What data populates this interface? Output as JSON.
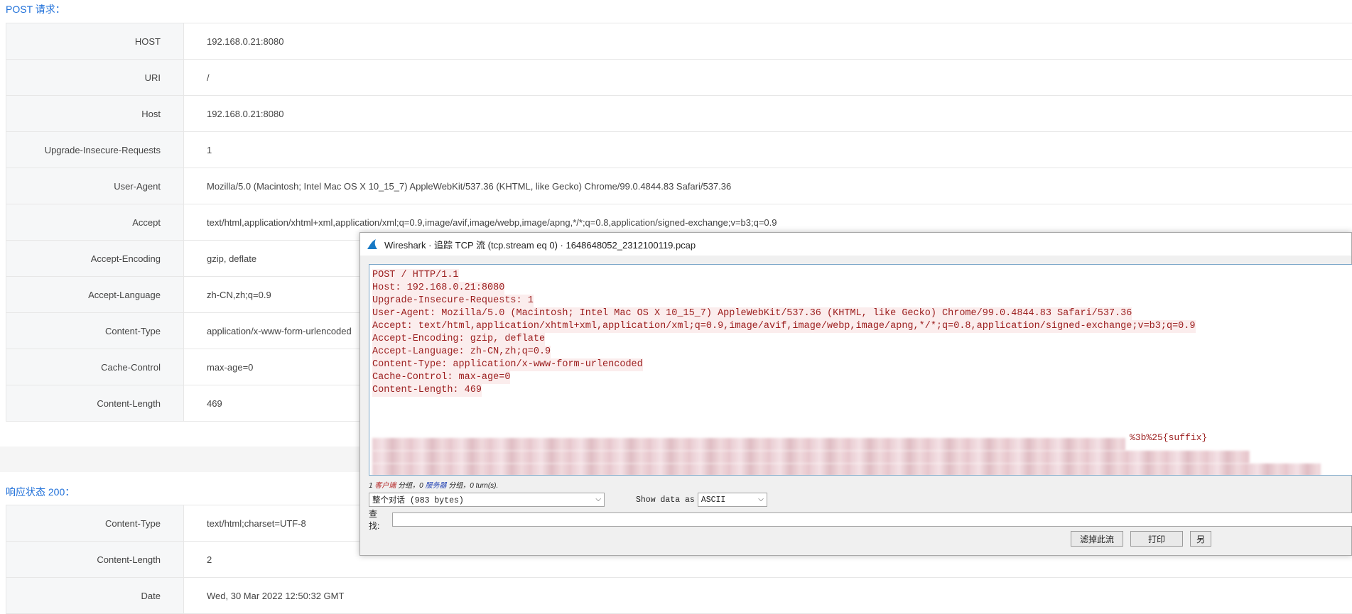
{
  "request": {
    "title": "POST 请求：",
    "rows": [
      {
        "key": "HOST",
        "value": "192.168.0.21:8080"
      },
      {
        "key": "URI",
        "value": "/"
      },
      {
        "key": "Host",
        "value": "192.168.0.21:8080"
      },
      {
        "key": "Upgrade-Insecure-Requests",
        "value": "1"
      },
      {
        "key": "User-Agent",
        "value": "Mozilla/5.0 (Macintosh; Intel Mac OS X 10_15_7) AppleWebKit/537.36 (KHTML, like Gecko) Chrome/99.0.4844.83 Safari/537.36"
      },
      {
        "key": "Accept",
        "value": "text/html,application/xhtml+xml,application/xml;q=0.9,image/avif,image/webp,image/apng,*/*;q=0.8,application/signed-exchange;v=b3;q=0.9"
      },
      {
        "key": "Accept-Encoding",
        "value": "gzip, deflate"
      },
      {
        "key": "Accept-Language",
        "value": "zh-CN,zh;q=0.9"
      },
      {
        "key": "Content-Type",
        "value": "application/x-www-form-urlencoded"
      },
      {
        "key": "Cache-Control",
        "value": "max-age=0"
      },
      {
        "key": "Content-Length",
        "value": "469"
      }
    ]
  },
  "response": {
    "title": "响应状态 200：",
    "rows": [
      {
        "key": "Content-Type",
        "value": "text/html;charset=UTF-8"
      },
      {
        "key": "Content-Length",
        "value": "2"
      },
      {
        "key": "Date",
        "value": "Wed, 30 Mar 2022 12:50:32 GMT"
      }
    ]
  },
  "wireshark": {
    "title": "Wireshark · 追踪 TCP 流 (tcp.stream eq 0) · 1648648052_2312100119.pcap",
    "lines": [
      "POST / HTTP/1.1",
      "Host: 192.168.0.21:8080",
      "Upgrade-Insecure-Requests: 1",
      "User-Agent: Mozilla/5.0 (Macintosh; Intel Mac OS X 10_15_7) AppleWebKit/537.36 (KHTML, like Gecko) Chrome/99.0.4844.83 Safari/537.36",
      "Accept: text/html,application/xhtml+xml,application/xml;q=0.9,image/avif,image/webp,image/apng,*/*;q=0.8,application/signed-exchange;v=b3;q=0.9",
      "Accept-Encoding: gzip, deflate",
      "Accept-Language: zh-CN,zh;q=0.9",
      "Content-Type: application/x-www-form-urlencoded",
      "Cache-Control: max-age=0",
      "Content-Length: 469"
    ],
    "body_visible_fragment": "%3b%25{suffix}",
    "summary": {
      "prefix": "1 ",
      "client": "客户端",
      "mid": " 分组，0 ",
      "server": "服务器",
      "suffix": " 分组，0 turn(s)."
    },
    "conversation_select": "整个对话 (983 bytes)",
    "show_data_label": "Show data as",
    "show_data_value": "ASCII",
    "find_label": "查找:",
    "buttons": {
      "filter": "滤掉此流",
      "print": "打印",
      "save": "另"
    },
    "colors": {
      "client_bg": "#fbeded",
      "client_fg": "#9b1d1d",
      "accent": "#1e6fd9"
    }
  }
}
